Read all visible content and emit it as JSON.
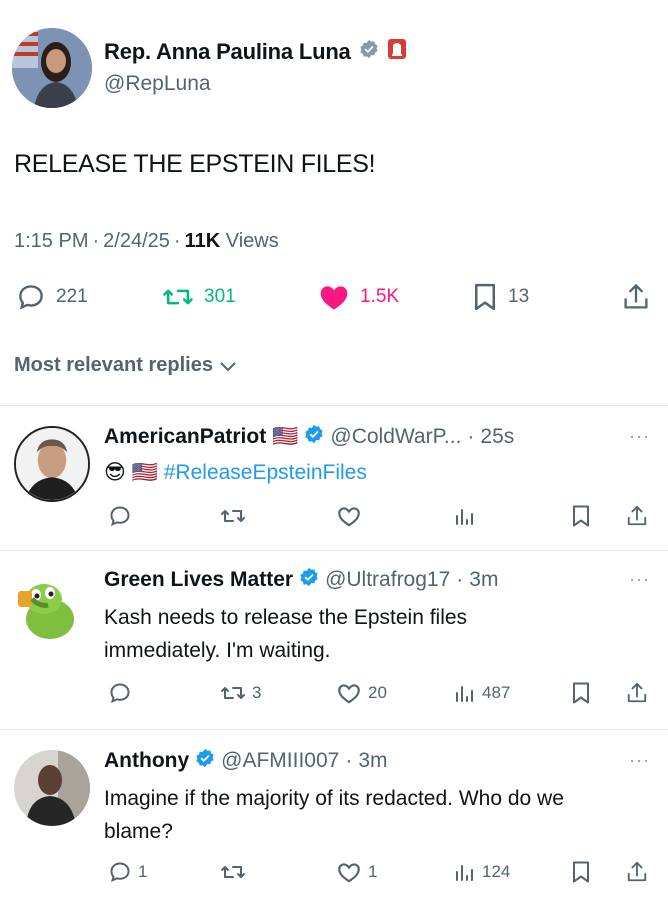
{
  "tweet": {
    "author_name": "Rep. Anna Paulina Luna",
    "handle": "@RepLuna",
    "text": "RELEASE THE EPSTEIN FILES!",
    "time": "1:15 PM",
    "date": "2/24/25",
    "views_count": "11K",
    "views_label": "Views",
    "replies": "221",
    "retweets": "301",
    "likes": "1.5K",
    "bookmarks": "13",
    "icons": [
      "verified-gray-icon",
      "congress-badge-icon",
      "reply-icon",
      "retweet-icon",
      "heart-filled-icon",
      "bookmark-icon",
      "share-icon"
    ]
  },
  "replies_filter": "Most relevant replies",
  "replies": [
    {
      "name": "AmericanPatriot",
      "flag": "🇺🇸",
      "handle": "@ColdWarP...",
      "time": "25s",
      "text_emoji": "😎",
      "text_flag": "🇺🇸",
      "text_hashtag": "#ReleaseEpsteinFiles",
      "retweets": "",
      "likes": "",
      "views": ""
    },
    {
      "name": "Green Lives Matter",
      "handle": "@Ultrafrog17",
      "time": "3m",
      "text": "Kash needs to release the Epstein files immediately. I'm waiting.",
      "retweets": "3",
      "likes": "20",
      "views": "487"
    },
    {
      "name": "Anthony",
      "handle": "@AFMIII007",
      "time": "3m",
      "text": "Imagine if the majority of its redacted.  Who do we blame?",
      "replies": "1",
      "likes": "1",
      "views": "124"
    }
  ],
  "colors": {
    "text": "#0f1419",
    "secondary": "#536471",
    "retweet_green": "#00ba7c",
    "like_pink": "#f91880",
    "link_blue": "#1d9bf0",
    "verified_blue": "#1d9bf0",
    "verified_gray": "#829aab"
  },
  "separator": "·"
}
